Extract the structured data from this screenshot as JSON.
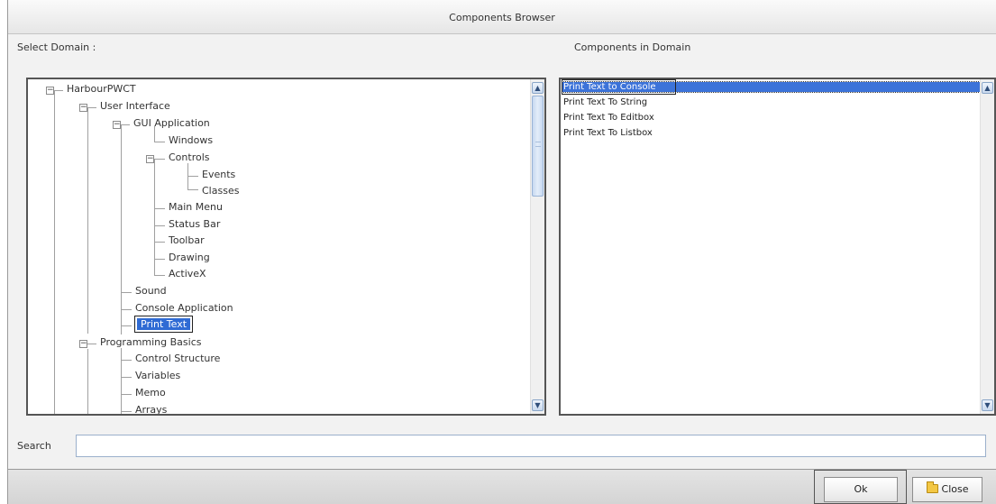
{
  "window": {
    "title": "Components Browser"
  },
  "labels": {
    "select_domain": "Select Domain :",
    "components_in_domain": "Components in Domain"
  },
  "tree": {
    "root": "HarbourPWCT",
    "user_interface": "User Interface",
    "gui_application": "GUI Application",
    "windows": "Windows",
    "controls": "Controls",
    "events": "Events",
    "classes": "Classes",
    "main_menu": "Main Menu",
    "status_bar": "Status Bar",
    "toolbar": "Toolbar",
    "drawing": "Drawing",
    "activex": "ActiveX",
    "sound": "Sound",
    "console_application": "Console Application",
    "print_text": "Print Text",
    "programming_basics": "Programming Basics",
    "control_structure": "Control Structure",
    "variables": "Variables",
    "memo": "Memo",
    "arrays": "Arrays",
    "expanded_symbol": "−",
    "selected": "Print Text"
  },
  "components": {
    "items": [
      "Print Text to Console",
      "Print Text To String",
      "Print Text To Editbox",
      "Print Text To Listbox"
    ],
    "selected_index": 0
  },
  "search": {
    "label": "Search",
    "value": ""
  },
  "buttons": {
    "ok": "Ok",
    "close": "Close"
  },
  "icons": {
    "scroll_up": "▲",
    "scroll_down": "▼",
    "close_button_icon": "folder-icon"
  },
  "colors": {
    "selection": "#2f6bd4",
    "background": "#f2f2f2"
  }
}
